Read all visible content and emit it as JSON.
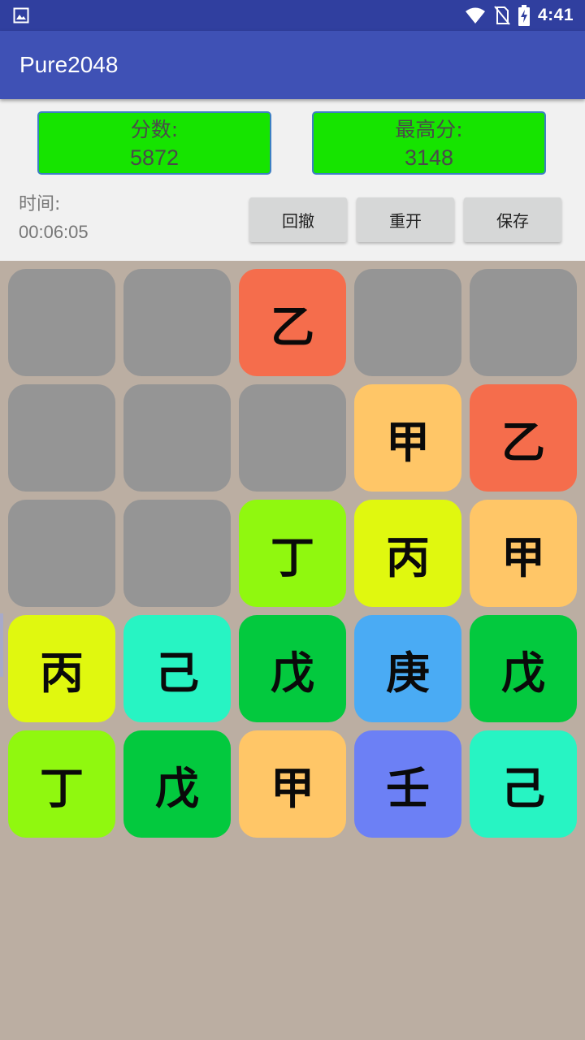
{
  "status_bar": {
    "time": "4:41",
    "icons": [
      "image-icon",
      "wifi-icon",
      "no-sim-icon",
      "battery-charging-icon"
    ],
    "background": "#303f9f"
  },
  "app_bar": {
    "title": "Pure2048",
    "background": "#3f51b5"
  },
  "scores": {
    "score_label": "分数:",
    "score_value": "5872",
    "best_label": "最高分:",
    "best_value": "3148",
    "box_color": "#16e400"
  },
  "timer": {
    "label": "时间:",
    "value": "00:06:05"
  },
  "controls": {
    "undo_label": "回撤",
    "restart_label": "重开",
    "save_label": "保存"
  },
  "board": {
    "empty_color": "#959595",
    "background": "#bbaea2",
    "tile_colors": {
      "甲": "#ffc667",
      "乙": "#f56d4c",
      "丙": "#e0f80f",
      "丁": "#90f80f",
      "戊": "#03c93e",
      "己": "#27f4c3",
      "庚": "#4aabf4",
      "壬": "#6c80f5"
    },
    "cells": [
      [
        "",
        "",
        "乙",
        "",
        ""
      ],
      [
        "",
        "",
        "",
        "甲",
        "乙"
      ],
      [
        "",
        "",
        "丁",
        "丙",
        "甲"
      ],
      [
        "丙",
        "己",
        "戊",
        "庚",
        "戊"
      ],
      [
        "丁",
        "戊",
        "甲",
        "壬",
        "己"
      ]
    ]
  }
}
